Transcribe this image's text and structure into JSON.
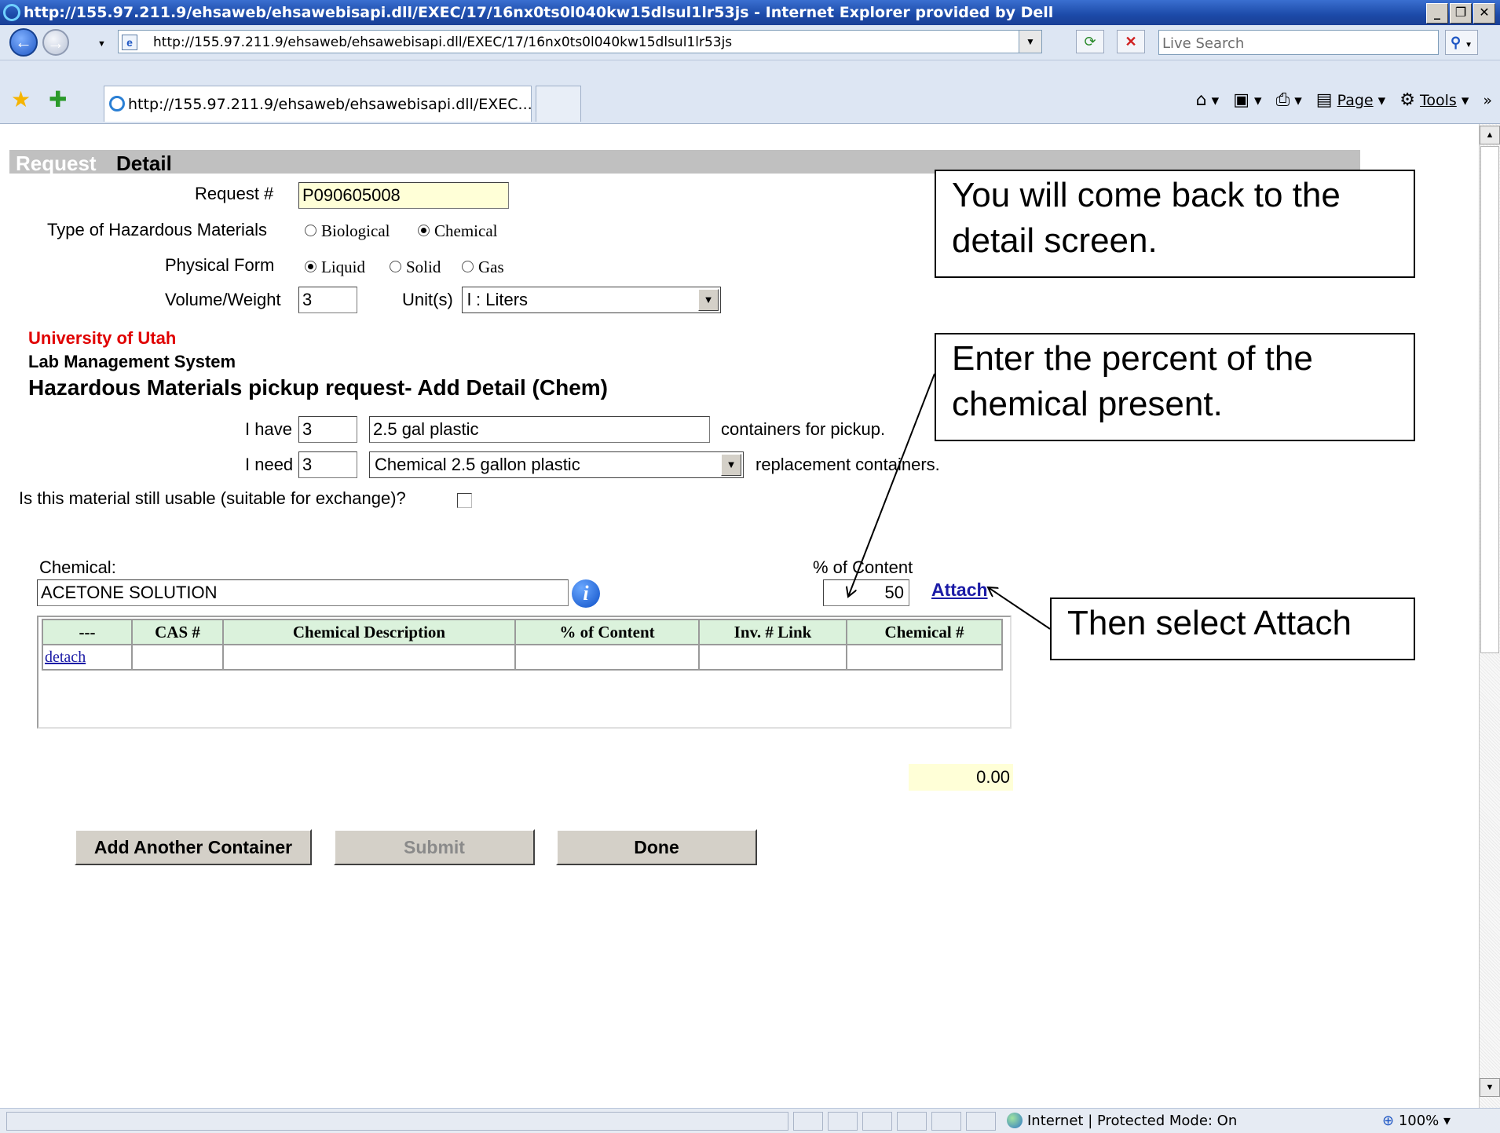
{
  "window": {
    "title": "http://155.97.211.9/ehsaweb/ehsawebisapi.dll/EXEC/17/16nx0ts0l040kw15dlsul1lr53js - Internet Explorer provided by Dell"
  },
  "nav": {
    "address": "http://155.97.211.9/ehsaweb/ehsawebisapi.dll/EXEC/17/16nx0ts0l040kw15dlsul1lr53js",
    "search_placeholder": "Live Search"
  },
  "tabs": {
    "active_tab": "http://155.97.211.9/ehsaweb/ehsawebisapi.dll/EXEC..."
  },
  "command_bar": {
    "page_label": "Page",
    "tools_label": "Tools",
    "overflow": "»"
  },
  "page": {
    "header_request": "Request",
    "header_detail": "Detail",
    "request_label": "Request #",
    "request_value": "P090605008",
    "type_label": "Type of Hazardous Materials",
    "type_options": [
      "Biological",
      "Chemical"
    ],
    "type_selected": "Chemical",
    "form_label": "Physical Form",
    "form_options": [
      "Liquid",
      "Solid",
      "Gas"
    ],
    "form_selected": "Liquid",
    "volume_label": "Volume/Weight",
    "volume_value": "3",
    "unit_label": "Unit(s)",
    "unit_value": "l : Liters",
    "org": "University of Utah",
    "system": "Lab Management System",
    "form_title": "Hazardous Materials pickup request- Add Detail (Chem)",
    "have_label": "I have",
    "have_qty": "3",
    "have_container": "2.5 gal plastic",
    "have_suffix": "containers for pickup.",
    "need_label": "I need",
    "need_qty": "3",
    "need_container": "Chemical 2.5 gallon plastic",
    "need_suffix": "replacement containers.",
    "usable_question": "Is this material still usable (suitable for exchange)?",
    "chemical_label": "Chemical:",
    "chemical_value": "ACETONE SOLUTION",
    "percent_label": "% of Content",
    "percent_value": "50",
    "attach_link": "Attach",
    "total": "0.00",
    "buttons": {
      "add_another": "Add Another Container",
      "submit": "Submit",
      "done": "Done"
    }
  },
  "table": {
    "headers": [
      "---",
      "CAS #",
      "Chemical Description",
      "% of Content",
      "Inv. # Link",
      "Chemical #"
    ],
    "rows": [
      {
        "action": "detach",
        "cas": "",
        "description": "",
        "percent": "",
        "inv_link": "",
        "chemical_no": ""
      }
    ]
  },
  "callouts": {
    "back_to_detail": "You will come back to the detail screen.",
    "enter_percent": "Enter the percent of the chemical present.",
    "select_attach": "Then select Attach"
  },
  "status": {
    "zone": "Internet | Protected Mode: On",
    "zoom": "100%"
  },
  "icons": [
    "ie-logo-icon",
    "back-arrow-icon",
    "forward-arrow-icon",
    "refresh-icon",
    "stop-icon",
    "search-icon",
    "favorites-star-icon",
    "add-favorites-icon",
    "home-icon",
    "feeds-icon",
    "print-icon",
    "page-icon",
    "tools-gear-icon",
    "info-icon",
    "globe-icon",
    "zoom-icon"
  ]
}
